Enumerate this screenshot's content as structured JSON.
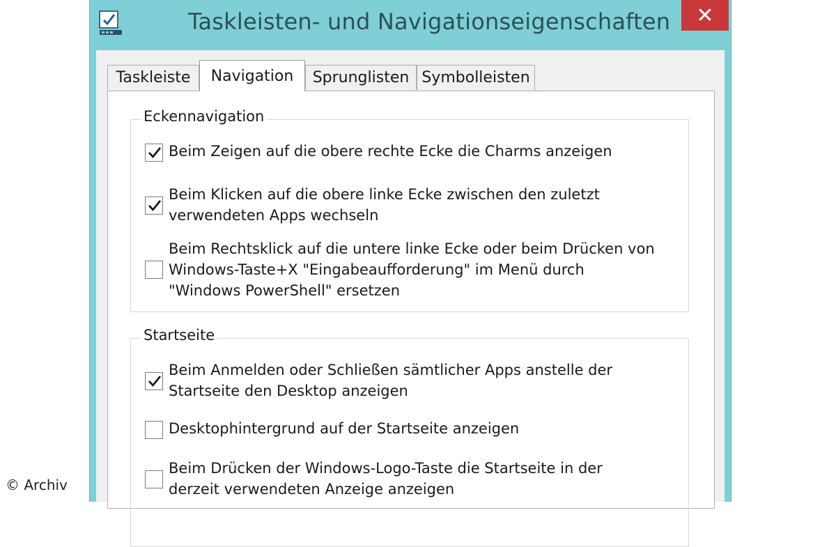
{
  "window": {
    "title": "Taskleisten- und Navigationseigenschaften",
    "close_label": "✕"
  },
  "tabs": [
    {
      "label": "Taskleiste",
      "active": false
    },
    {
      "label": "Navigation",
      "active": true
    },
    {
      "label": "Sprunglisten",
      "active": false
    },
    {
      "label": "Symbolleisten",
      "active": false
    }
  ],
  "groups": [
    {
      "title": "Eckennavigation",
      "options": [
        {
          "checked": true,
          "lines": [
            "Beim Zeigen auf die obere rechte Ecke die Charms anzeigen"
          ]
        },
        {
          "checked": true,
          "lines": [
            "Beim Klicken auf die obere linke Ecke zwischen den zuletzt",
            "verwendeten Apps wechseln"
          ]
        },
        {
          "checked": false,
          "lines": [
            "Beim Rechtsklick auf die untere linke Ecke oder beim Drücken von",
            "Windows-Taste+X \"Eingabeaufforderung\" im Menü durch",
            "\"Windows PowerShell\" ersetzen"
          ]
        }
      ]
    },
    {
      "title": "Startseite",
      "options": [
        {
          "checked": true,
          "lines": [
            "Beim Anmelden oder Schließen sämtlicher Apps anstelle der",
            "Startseite den Desktop anzeigen"
          ]
        },
        {
          "checked": false,
          "lines": [
            "Desktophintergrund auf der Startseite anzeigen"
          ]
        },
        {
          "checked": false,
          "lines": [
            "Beim Drücken der Windows-Logo-Taste die Startseite in der",
            "derzeit verwendeten Anzeige anzeigen"
          ]
        }
      ]
    }
  ],
  "watermark": "© Archiv",
  "colors": {
    "title_bar": "#7fcfd6",
    "close_button": "#c9383a",
    "checkmark": "#111111"
  },
  "icons": {
    "app": "taskbar-properties-icon",
    "checkmark": "checkmark-icon"
  }
}
